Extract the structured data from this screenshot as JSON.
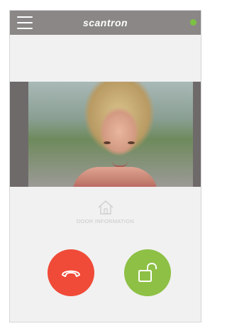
{
  "app": {
    "brand": "scantron"
  },
  "colors": {
    "topbar": "#8a8786",
    "status": "#7cc242",
    "hangup": "#f04b38",
    "unlock": "#8dc045"
  },
  "door": {
    "label": "DOOR INFORMATION",
    "icon": "house-icon"
  },
  "actions": {
    "hangup_icon": "phone-hangup-icon",
    "unlock_icon": "open-padlock-icon"
  }
}
